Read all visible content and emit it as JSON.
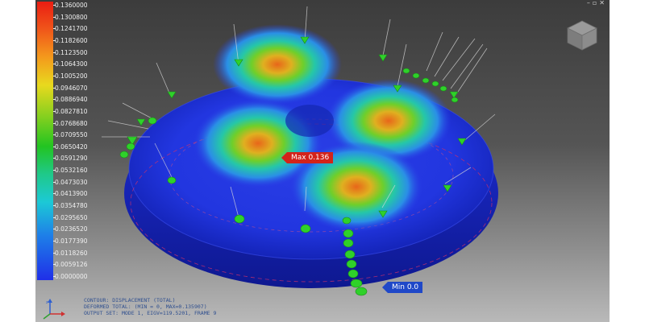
{
  "legend": {
    "colors": {
      "top": "#ea1d12",
      "bottom": "#1f2fe8"
    },
    "labels": [
      "0.1360000",
      "0.1300800",
      "0.1241700",
      "0.1182600",
      "0.1123500",
      "0.1064300",
      "0.1005200",
      "0.0946070",
      "0.0886940",
      "0.0827810",
      "0.0768680",
      "0.0709550",
      "0.0650420",
      "0.0591290",
      "0.0532160",
      "0.0473030",
      "0.0413900",
      "0.0354780",
      "0.0295650",
      "0.0236520",
      "0.0177390",
      "0.0118260",
      "0.0059126",
      "0.0000000"
    ]
  },
  "markers": {
    "max": "Max 0.136",
    "min": "Min 0.0"
  },
  "info": [
    "CONTOUR: DISPLACEMENT (TOTAL)",
    "DEFORMED TOTAL: (MIN = 0, MAX=0.135907)",
    "OUTPUT SET: MODE 1, EIGV=119.5201, FRAME   9"
  ],
  "window_controls": {
    "minimize": "–",
    "restore": "▫",
    "close": "✕"
  },
  "view_cube_icon": "view-cube-icon",
  "triad_icon": "axis-triad-icon",
  "constraint_marker_color": "#2fd12a"
}
